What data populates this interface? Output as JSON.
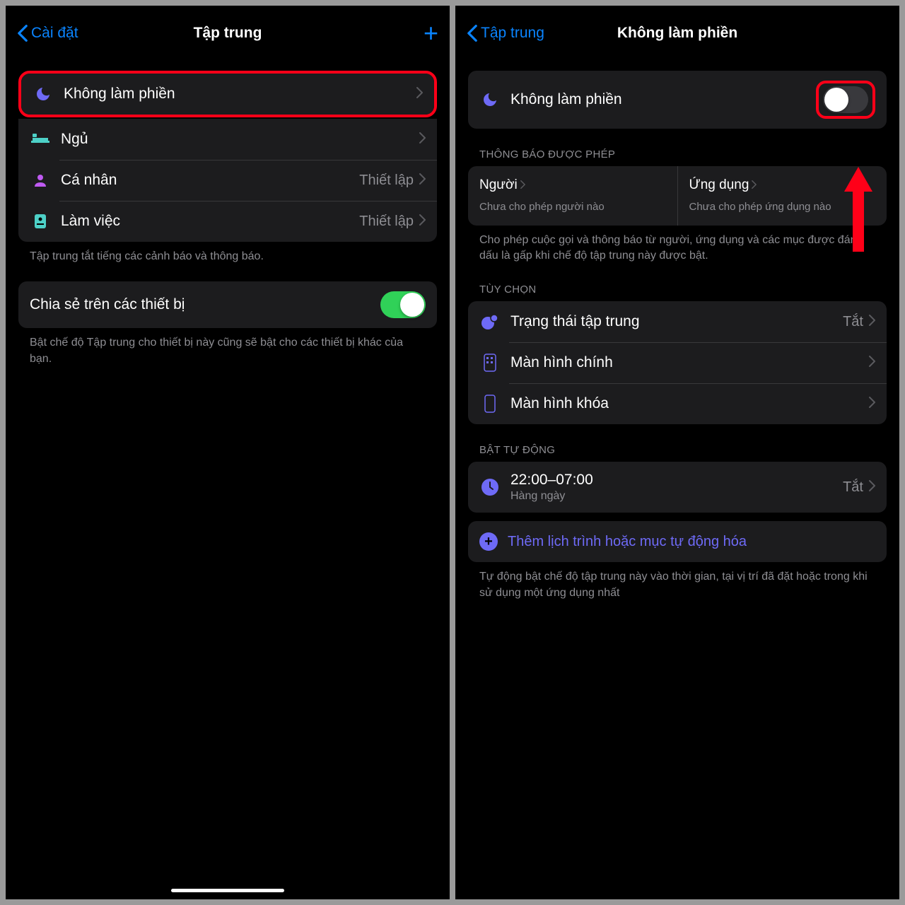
{
  "left": {
    "back": "Cài đặt",
    "title": "Tập trung",
    "items": [
      {
        "label": "Không làm phiền"
      },
      {
        "label": "Ngủ"
      },
      {
        "label": "Cá nhân",
        "value": "Thiết lập"
      },
      {
        "label": "Làm việc",
        "value": "Thiết lập"
      }
    ],
    "footer1": "Tập trung tắt tiếng các cảnh báo và thông báo.",
    "share_label": "Chia sẻ trên các thiết bị",
    "footer2": "Bật chế độ Tập trung cho thiết bị này cũng sẽ bật cho các thiết bị khác của bạn."
  },
  "right": {
    "back": "Tập trung",
    "title": "Không làm phiền",
    "main_label": "Không làm phiền",
    "allowed_header": "THÔNG BÁO ĐƯỢC PHÉP",
    "people_title": "Người",
    "people_sub": "Chưa cho phép người nào",
    "apps_title": "Ứng dụng",
    "apps_sub": "Chưa cho phép ứng dụng nào",
    "allowed_footer": "Cho phép cuộc gọi và thông báo từ người, ứng dụng và các mục được đánh dấu là gấp khi chế độ tập trung này được bật.",
    "options_header": "TÙY CHỌN",
    "focus_status_label": "Trạng thái tập trung",
    "focus_status_value": "Tắt",
    "home_screen_label": "Màn hình chính",
    "lock_screen_label": "Màn hình khóa",
    "auto_header": "BẬT TỰ ĐỘNG",
    "schedule_time": "22:00–07:00",
    "schedule_sub": "Hàng ngày",
    "schedule_value": "Tắt",
    "add_schedule": "Thêm lịch trình hoặc mục tự động hóa",
    "auto_footer": "Tự động bật chế độ tập trung này vào thời gian, tại vị trí đã đặt hoặc trong khi sử dụng một ứng dụng nhất"
  }
}
